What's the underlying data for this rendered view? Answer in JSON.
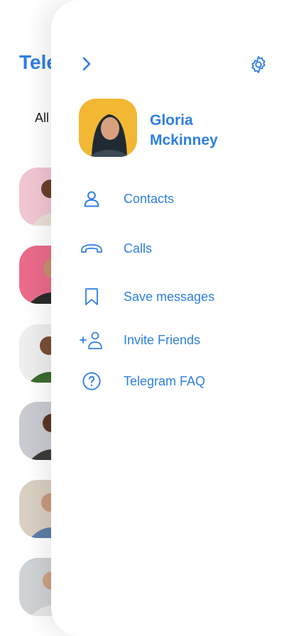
{
  "background": {
    "app_title": "Tele",
    "tab_label": "All"
  },
  "profile": {
    "first_name": "Gloria",
    "last_name": "Mckinney"
  },
  "menu": [
    {
      "label": "Contacts",
      "icon": "contacts-icon"
    },
    {
      "label": "Calls",
      "icon": "phone-icon"
    },
    {
      "label": "Save messages",
      "icon": "bookmark-icon"
    },
    {
      "label": "Invite Friends",
      "icon": "add-user-icon"
    },
    {
      "label": "Telegram FAQ",
      "icon": "help-icon"
    }
  ],
  "colors": {
    "accent": "#2f7fe0",
    "text_dark": "#1a1a1a",
    "background": "#ffffff"
  }
}
